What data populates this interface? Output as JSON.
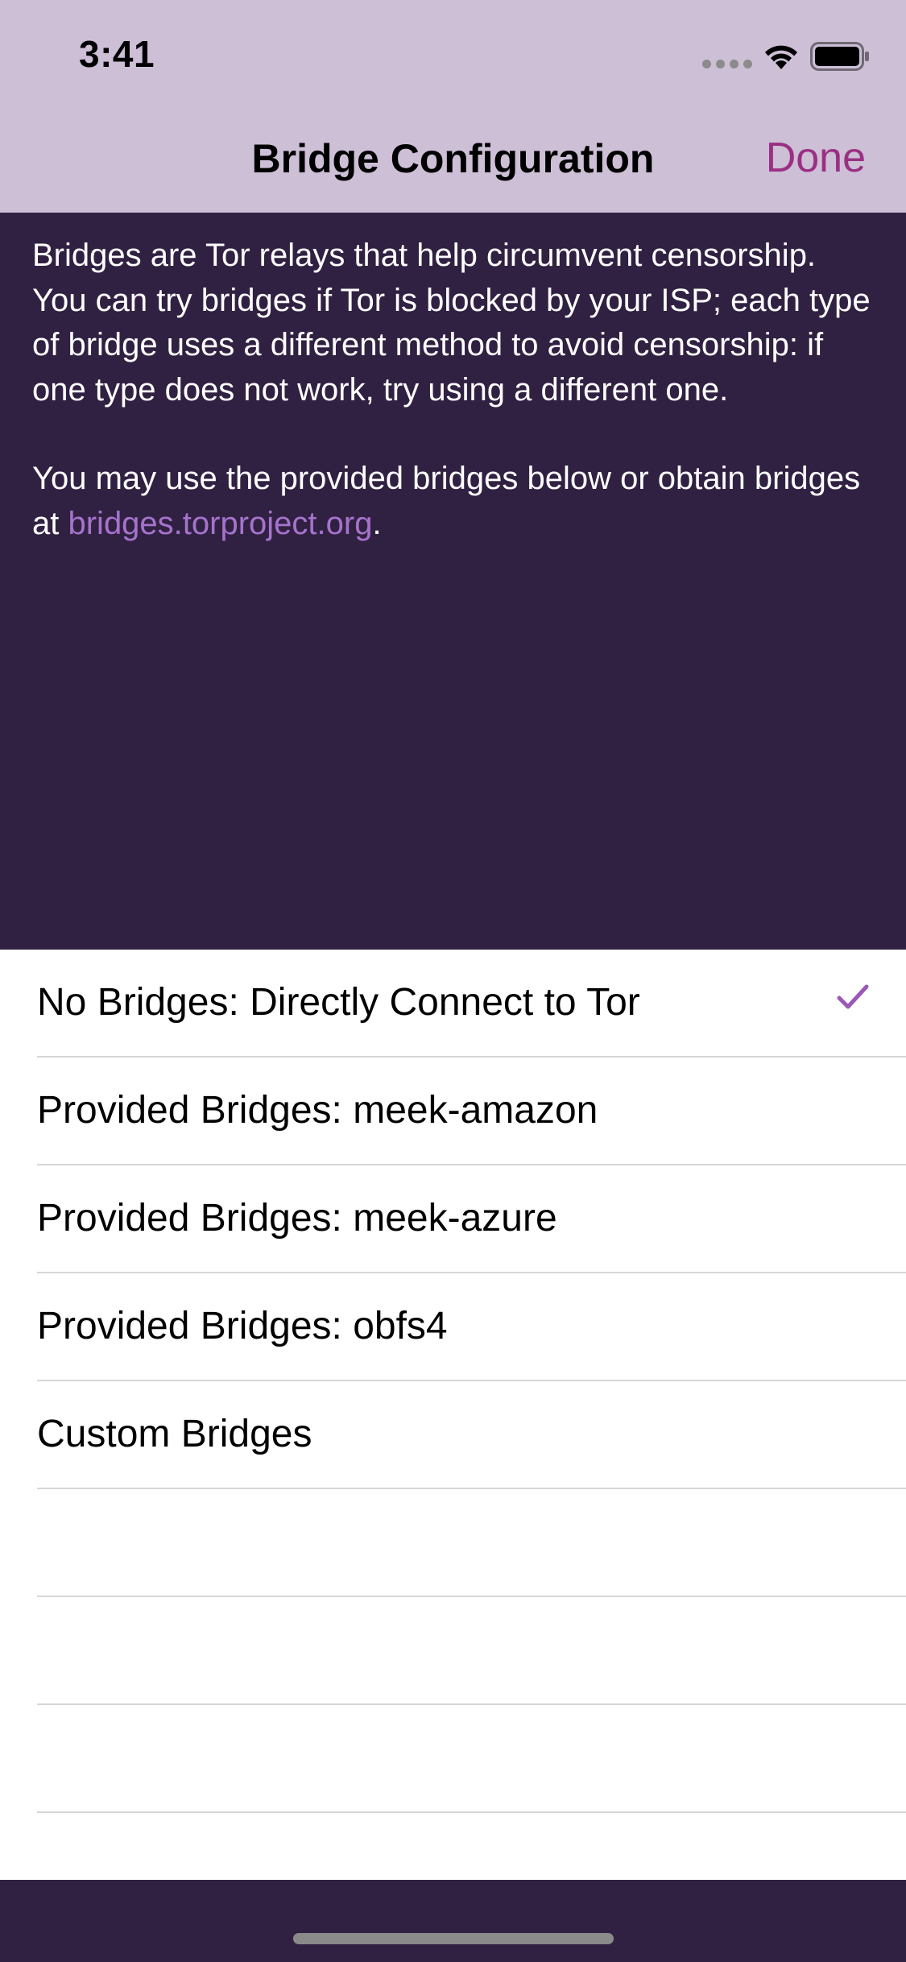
{
  "status_bar": {
    "time": "3:41"
  },
  "nav": {
    "title": "Bridge Configuration",
    "done_label": "Done"
  },
  "info": {
    "paragraph1": "Bridges are Tor relays that help circumvent censorship. You can try bridges if Tor is blocked by your ISP; each type of bridge uses a different method to avoid censorship: if one type does not work, try using a different one.",
    "paragraph2_prefix": "You may use the provided bridges below or obtain bridges at ",
    "link_text": "bridges.torproject.org",
    "paragraph2_suffix": "."
  },
  "options": [
    {
      "label": "No Bridges: Directly Connect to Tor",
      "selected": true
    },
    {
      "label": "Provided Bridges: meek-amazon",
      "selected": false
    },
    {
      "label": "Provided Bridges: meek-azure",
      "selected": false
    },
    {
      "label": "Provided Bridges: obfs4",
      "selected": false
    },
    {
      "label": "Custom Bridges",
      "selected": false
    }
  ],
  "colors": {
    "header_bg": "#ccbfd6",
    "content_bg": "#302142",
    "accent": "#9b2f83",
    "link": "#a673cc",
    "checkmark": "#9b59b6"
  },
  "icons": {
    "signal": "signal-dots-icon",
    "wifi": "wifi-icon",
    "battery": "battery-icon",
    "selected": "checkmark-icon"
  }
}
